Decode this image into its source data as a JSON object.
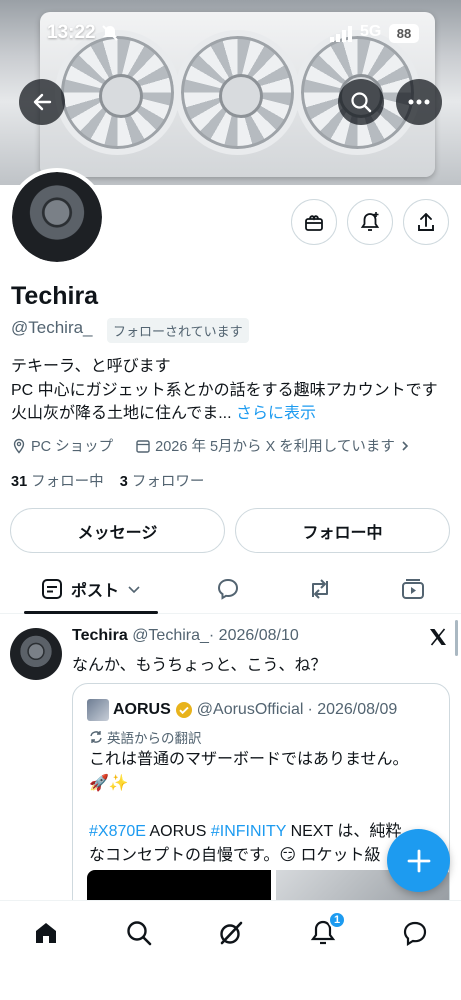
{
  "status_bar": {
    "time": "13:22",
    "network": "5G",
    "battery": "88"
  },
  "profile": {
    "name": "Techira",
    "handle": "@Techira_",
    "follows_you": "フォローされています",
    "bio_line1": "テキーラ、と呼びます",
    "bio_line2": "PC 中心にガジェット系とかの話をする趣味アカウントです",
    "bio_line3": "火山灰が降る土地に住んでま...",
    "bio_more": "さらに表示",
    "category": "PC ショップ",
    "joined": "2026 年 5月から X を利用しています",
    "following_count": "31",
    "following_label": "フォロー中",
    "followers_count": "3",
    "followers_label": "フォロワー",
    "message_button": "メッセージ",
    "following_button": "フォロー中"
  },
  "tabs": {
    "posts_label": "ポスト"
  },
  "tweet": {
    "author_name": "Techira",
    "author_handle": "@Techira_",
    "date": "· 2026/08/10",
    "text": "なんか、もうちょっと、こう、ね？",
    "quote": {
      "author_name": "AORUS",
      "author_handle": "@AorusOfficial",
      "date": "· 2026/08/09",
      "translated_label": "英語からの翻訳",
      "text_line1": "これは普通のマザーボードではありません。",
      "text_line2": "🚀✨",
      "hashtag1": "#X870E",
      "text_mid1": " AORUS ",
      "hashtag2": "#INFINITY",
      "text_mid2": " NEXT は、純粋",
      "text_line4": "なコンセプトの自慢です。😏 ロケット級"
    }
  },
  "bottom_nav": {
    "notification_count": "1"
  },
  "colors": {
    "accent": "#1d9bf0",
    "text": "#0f1419",
    "muted": "#536471"
  }
}
